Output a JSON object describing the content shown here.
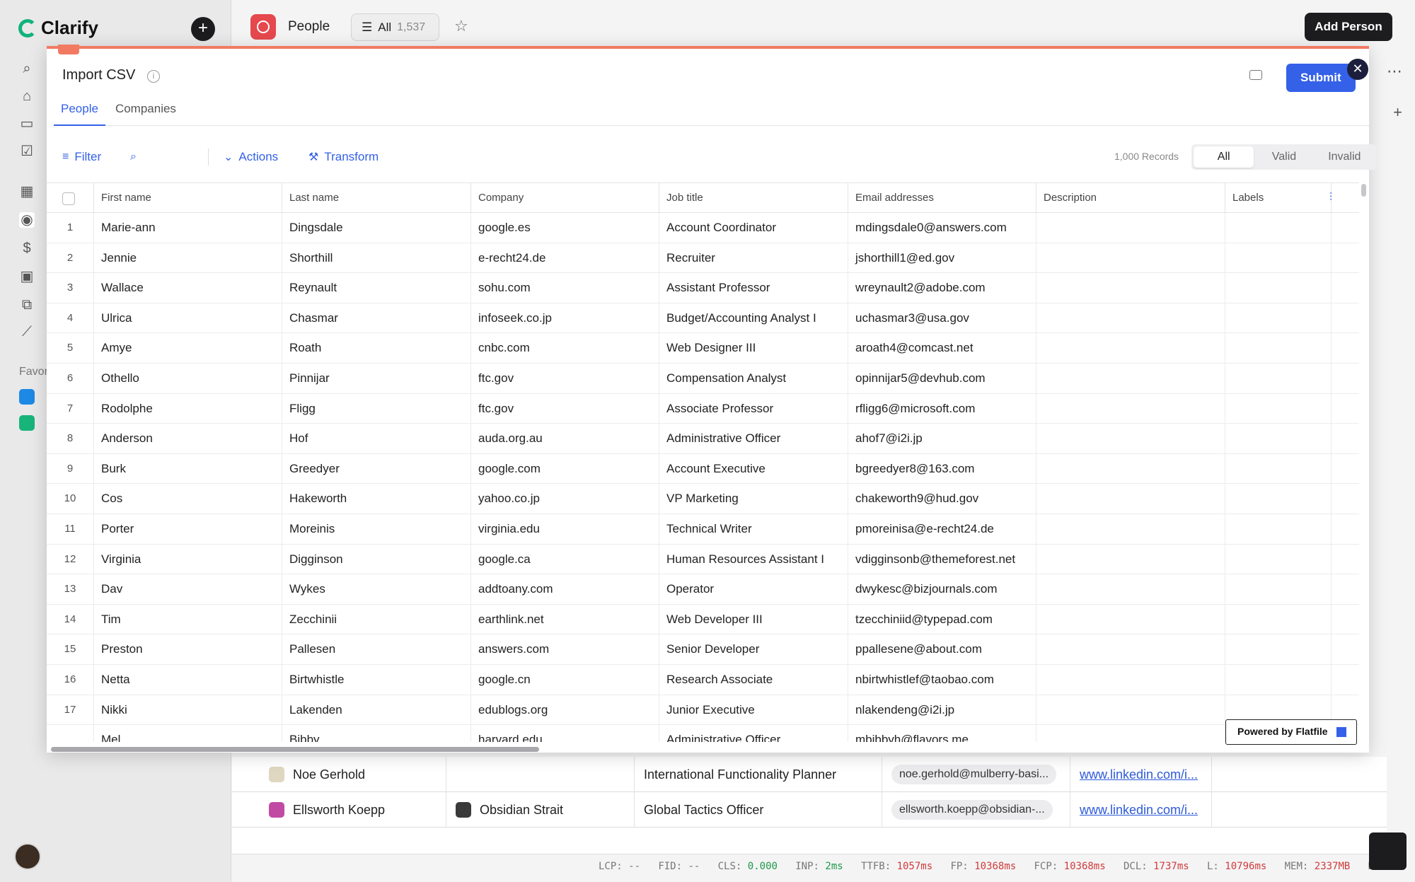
{
  "app": {
    "name": "Clarify",
    "favorites_label": "Favor"
  },
  "header": {
    "object_title": "People",
    "view_label": "All",
    "view_count": "1,537",
    "add_button": "Add Person"
  },
  "background_rows": [
    {
      "name": "Noe Gerhold",
      "company": "",
      "job_title": "International Functionality Planner",
      "email": "noe.gerhold@mulberry-basi...",
      "linkedin": "www.linkedin.com/i..."
    },
    {
      "name": "Ellsworth Koepp",
      "company": "Obsidian Strait",
      "job_title": "Global Tactics Officer",
      "email": "ellsworth.koepp@obsidian-...",
      "linkedin": "www.linkedin.com/i..."
    }
  ],
  "perf": {
    "lcp_label": "LCP:",
    "lcp": "--",
    "fid_label": "FID:",
    "fid": "--",
    "cls_label": "CLS:",
    "cls": "0.000",
    "inp_label": "INP:",
    "inp": "2ms",
    "ttfb_label": "TTFB:",
    "ttfb": "1057ms",
    "fp_label": "FP:",
    "fp": "10368ms",
    "fcp_label": "FCP:",
    "fcp": "10368ms",
    "dcl_label": "DCL:",
    "dcl": "1737ms",
    "l_label": "L:",
    "l": "10796ms",
    "mem_label": "MEM:",
    "mem": "2337MB",
    "dom_label": "DOM"
  },
  "modal": {
    "title": "Import CSV",
    "submit": "Submit",
    "tabs": [
      "People",
      "Companies"
    ],
    "toolbar": {
      "filter": "Filter",
      "actions": "Actions",
      "transform": "Transform",
      "records": "1,000 Records",
      "segments": [
        "All",
        "Valid",
        "Invalid"
      ]
    },
    "columns": [
      "First name",
      "Last name",
      "Company",
      "Job title",
      "Email addresses",
      "Description",
      "Labels"
    ],
    "rows": [
      [
        "1",
        "Marie-ann",
        "Dingsdale",
        "google.es",
        "Account Coordinator",
        "mdingsdale0@answers.com"
      ],
      [
        "2",
        "Jennie",
        "Shorthill",
        "e-recht24.de",
        "Recruiter",
        "jshorthill1@ed.gov"
      ],
      [
        "3",
        "Wallace",
        "Reynault",
        "sohu.com",
        "Assistant Professor",
        "wreynault2@adobe.com"
      ],
      [
        "4",
        "Ulrica",
        "Chasmar",
        "infoseek.co.jp",
        "Budget/Accounting Analyst I",
        "uchasmar3@usa.gov"
      ],
      [
        "5",
        "Amye",
        "Roath",
        "cnbc.com",
        "Web Designer III",
        "aroath4@comcast.net"
      ],
      [
        "6",
        "Othello",
        "Pinnijar",
        "ftc.gov",
        "Compensation Analyst",
        "opinnijar5@devhub.com"
      ],
      [
        "7",
        "Rodolphe",
        "Fligg",
        "ftc.gov",
        "Associate Professor",
        "rfligg6@microsoft.com"
      ],
      [
        "8",
        "Anderson",
        "Hof",
        "auda.org.au",
        "Administrative Officer",
        "ahof7@i2i.jp"
      ],
      [
        "9",
        "Burk",
        "Greedyer",
        "google.com",
        "Account Executive",
        "bgreedyer8@163.com"
      ],
      [
        "10",
        "Cos",
        "Hakeworth",
        "yahoo.co.jp",
        "VP Marketing",
        "chakeworth9@hud.gov"
      ],
      [
        "11",
        "Porter",
        "Moreinis",
        "virginia.edu",
        "Technical Writer",
        "pmoreinisa@e-recht24.de"
      ],
      [
        "12",
        "Virginia",
        "Digginson",
        "google.ca",
        "Human Resources Assistant I",
        "vdigginsonb@themeforest.net"
      ],
      [
        "13",
        "Dav",
        "Wykes",
        "addtoany.com",
        "Operator",
        "dwykesc@bizjournals.com"
      ],
      [
        "14",
        "Tim",
        "Zecchinii",
        "earthlink.net",
        "Web Developer III",
        "tzecchiniid@typepad.com"
      ],
      [
        "15",
        "Preston",
        "Pallesen",
        "answers.com",
        "Senior Developer",
        "ppallesene@about.com"
      ],
      [
        "16",
        "Netta",
        "Birtwhistle",
        "google.cn",
        "Research Associate",
        "nbirtwhistlef@taobao.com"
      ],
      [
        "17",
        "Nikki",
        "Lakenden",
        "edublogs.org",
        "Junior Executive",
        "nlakendeng@i2i.jp"
      ],
      [
        "",
        "Mel",
        "Bibby",
        "harvard.edu",
        "Administrative Officer",
        "mbibbyh@flavors.me"
      ]
    ],
    "powered_by": "Powered by Flatfile"
  }
}
